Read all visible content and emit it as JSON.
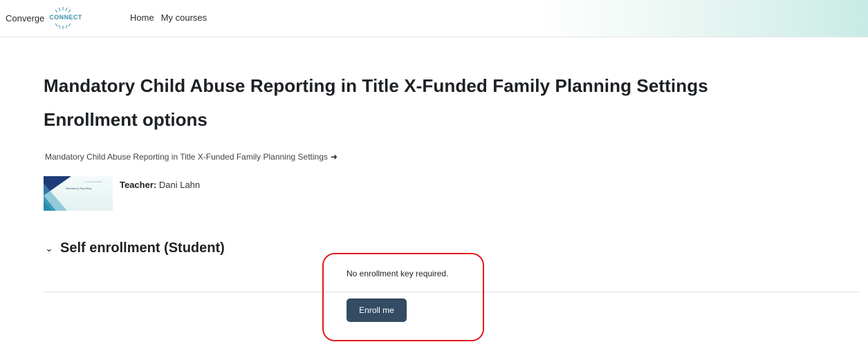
{
  "header": {
    "logo_text": "Converge",
    "logo_mark_text": "CONNECT",
    "nav": [
      {
        "label": "Home"
      },
      {
        "label": "My courses"
      }
    ]
  },
  "main": {
    "course_title": "Mandatory Child Abuse Reporting in Title X-Funded Family Planning Settings",
    "page_subtitle": "Enrollment options",
    "course_link": "Mandatory Child Abuse Reporting in Title X-Funded Family Planning Settings",
    "course_image_text": "Mandatory Reporting",
    "course_image_logo": "Converge Connect",
    "teacher_label": "Teacher:",
    "teacher_name": "Dani Lahn"
  },
  "enrollment": {
    "section_title": "Self enrollment (Student)",
    "key_message": "No enrollment key required.",
    "enroll_button": "Enroll me"
  },
  "colors": {
    "button": "#334b63",
    "highlight": "#e2171c",
    "brand_teal": "#3c8fa8"
  },
  "icons": {
    "enter": "enter-course-icon",
    "chevron": "chevron-down-icon"
  }
}
